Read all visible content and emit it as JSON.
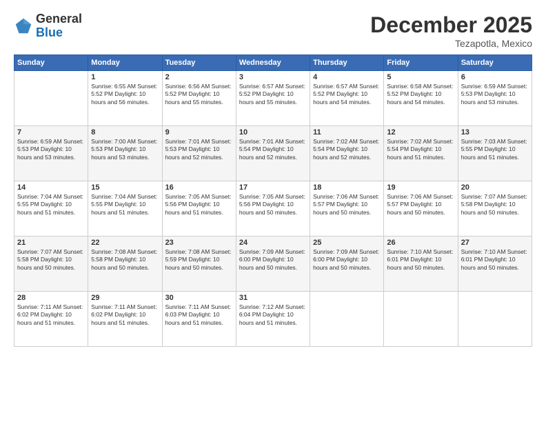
{
  "logo": {
    "general": "General",
    "blue": "Blue"
  },
  "title": "December 2025",
  "location": "Tezapotla, Mexico",
  "headers": [
    "Sunday",
    "Monday",
    "Tuesday",
    "Wednesday",
    "Thursday",
    "Friday",
    "Saturday"
  ],
  "weeks": [
    [
      {
        "day": "",
        "info": ""
      },
      {
        "day": "1",
        "info": "Sunrise: 6:55 AM\nSunset: 5:52 PM\nDaylight: 10 hours\nand 56 minutes."
      },
      {
        "day": "2",
        "info": "Sunrise: 6:56 AM\nSunset: 5:52 PM\nDaylight: 10 hours\nand 55 minutes."
      },
      {
        "day": "3",
        "info": "Sunrise: 6:57 AM\nSunset: 5:52 PM\nDaylight: 10 hours\nand 55 minutes."
      },
      {
        "day": "4",
        "info": "Sunrise: 6:57 AM\nSunset: 5:52 PM\nDaylight: 10 hours\nand 54 minutes."
      },
      {
        "day": "5",
        "info": "Sunrise: 6:58 AM\nSunset: 5:52 PM\nDaylight: 10 hours\nand 54 minutes."
      },
      {
        "day": "6",
        "info": "Sunrise: 6:59 AM\nSunset: 5:53 PM\nDaylight: 10 hours\nand 53 minutes."
      }
    ],
    [
      {
        "day": "7",
        "info": "Sunrise: 6:59 AM\nSunset: 5:53 PM\nDaylight: 10 hours\nand 53 minutes."
      },
      {
        "day": "8",
        "info": "Sunrise: 7:00 AM\nSunset: 5:53 PM\nDaylight: 10 hours\nand 53 minutes."
      },
      {
        "day": "9",
        "info": "Sunrise: 7:01 AM\nSunset: 5:53 PM\nDaylight: 10 hours\nand 52 minutes."
      },
      {
        "day": "10",
        "info": "Sunrise: 7:01 AM\nSunset: 5:54 PM\nDaylight: 10 hours\nand 52 minutes."
      },
      {
        "day": "11",
        "info": "Sunrise: 7:02 AM\nSunset: 5:54 PM\nDaylight: 10 hours\nand 52 minutes."
      },
      {
        "day": "12",
        "info": "Sunrise: 7:02 AM\nSunset: 5:54 PM\nDaylight: 10 hours\nand 51 minutes."
      },
      {
        "day": "13",
        "info": "Sunrise: 7:03 AM\nSunset: 5:55 PM\nDaylight: 10 hours\nand 51 minutes."
      }
    ],
    [
      {
        "day": "14",
        "info": "Sunrise: 7:04 AM\nSunset: 5:55 PM\nDaylight: 10 hours\nand 51 minutes."
      },
      {
        "day": "15",
        "info": "Sunrise: 7:04 AM\nSunset: 5:55 PM\nDaylight: 10 hours\nand 51 minutes."
      },
      {
        "day": "16",
        "info": "Sunrise: 7:05 AM\nSunset: 5:56 PM\nDaylight: 10 hours\nand 51 minutes."
      },
      {
        "day": "17",
        "info": "Sunrise: 7:05 AM\nSunset: 5:56 PM\nDaylight: 10 hours\nand 50 minutes."
      },
      {
        "day": "18",
        "info": "Sunrise: 7:06 AM\nSunset: 5:57 PM\nDaylight: 10 hours\nand 50 minutes."
      },
      {
        "day": "19",
        "info": "Sunrise: 7:06 AM\nSunset: 5:57 PM\nDaylight: 10 hours\nand 50 minutes."
      },
      {
        "day": "20",
        "info": "Sunrise: 7:07 AM\nSunset: 5:58 PM\nDaylight: 10 hours\nand 50 minutes."
      }
    ],
    [
      {
        "day": "21",
        "info": "Sunrise: 7:07 AM\nSunset: 5:58 PM\nDaylight: 10 hours\nand 50 minutes."
      },
      {
        "day": "22",
        "info": "Sunrise: 7:08 AM\nSunset: 5:58 PM\nDaylight: 10 hours\nand 50 minutes."
      },
      {
        "day": "23",
        "info": "Sunrise: 7:08 AM\nSunset: 5:59 PM\nDaylight: 10 hours\nand 50 minutes."
      },
      {
        "day": "24",
        "info": "Sunrise: 7:09 AM\nSunset: 6:00 PM\nDaylight: 10 hours\nand 50 minutes."
      },
      {
        "day": "25",
        "info": "Sunrise: 7:09 AM\nSunset: 6:00 PM\nDaylight: 10 hours\nand 50 minutes."
      },
      {
        "day": "26",
        "info": "Sunrise: 7:10 AM\nSunset: 6:01 PM\nDaylight: 10 hours\nand 50 minutes."
      },
      {
        "day": "27",
        "info": "Sunrise: 7:10 AM\nSunset: 6:01 PM\nDaylight: 10 hours\nand 50 minutes."
      }
    ],
    [
      {
        "day": "28",
        "info": "Sunrise: 7:11 AM\nSunset: 6:02 PM\nDaylight: 10 hours\nand 51 minutes."
      },
      {
        "day": "29",
        "info": "Sunrise: 7:11 AM\nSunset: 6:02 PM\nDaylight: 10 hours\nand 51 minutes."
      },
      {
        "day": "30",
        "info": "Sunrise: 7:11 AM\nSunset: 6:03 PM\nDaylight: 10 hours\nand 51 minutes."
      },
      {
        "day": "31",
        "info": "Sunrise: 7:12 AM\nSunset: 6:04 PM\nDaylight: 10 hours\nand 51 minutes."
      },
      {
        "day": "",
        "info": ""
      },
      {
        "day": "",
        "info": ""
      },
      {
        "day": "",
        "info": ""
      }
    ]
  ]
}
